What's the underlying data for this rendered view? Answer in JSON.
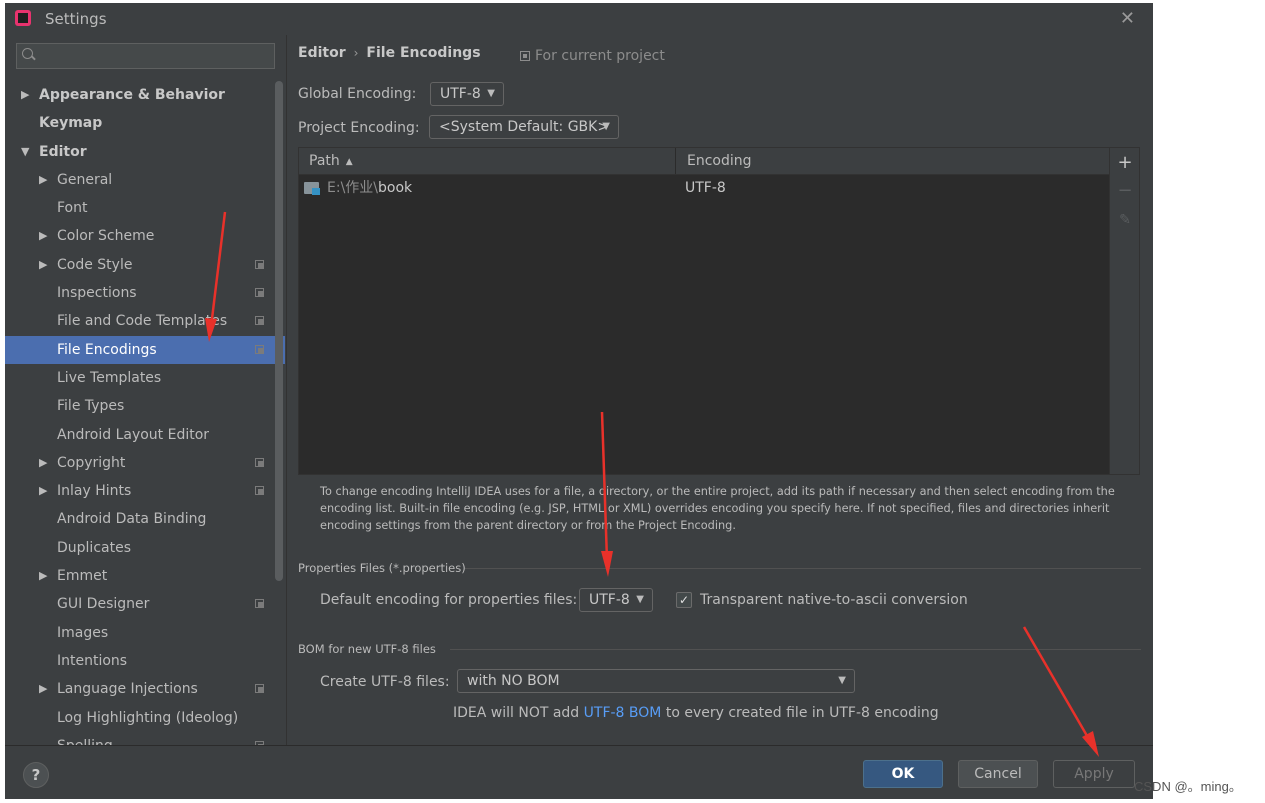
{
  "window": {
    "title": "Settings"
  },
  "sidebar": {
    "search_placeholder": "",
    "items": [
      {
        "label": "Appearance & Behavior",
        "level": 0,
        "arrow": "▶",
        "bold": true
      },
      {
        "label": "Keymap",
        "level": 0,
        "arrow": "",
        "bold": true
      },
      {
        "label": "Editor",
        "level": 0,
        "arrow": "▼",
        "bold": true
      },
      {
        "label": "General",
        "level": 1,
        "arrow": "▶"
      },
      {
        "label": "Font",
        "level": 1,
        "arrow": ""
      },
      {
        "label": "Color Scheme",
        "level": 1,
        "arrow": "▶"
      },
      {
        "label": "Code Style",
        "level": 1,
        "arrow": "▶",
        "project": true
      },
      {
        "label": "Inspections",
        "level": 1,
        "arrow": "",
        "project": true
      },
      {
        "label": "File and Code Templates",
        "level": 1,
        "arrow": "",
        "project": true
      },
      {
        "label": "File Encodings",
        "level": 1,
        "arrow": "",
        "project": true,
        "selected": true
      },
      {
        "label": "Live Templates",
        "level": 1,
        "arrow": ""
      },
      {
        "label": "File Types",
        "level": 1,
        "arrow": ""
      },
      {
        "label": "Android Layout Editor",
        "level": 1,
        "arrow": ""
      },
      {
        "label": "Copyright",
        "level": 1,
        "arrow": "▶",
        "project": true
      },
      {
        "label": "Inlay Hints",
        "level": 1,
        "arrow": "▶",
        "project": true
      },
      {
        "label": "Android Data Binding",
        "level": 1,
        "arrow": ""
      },
      {
        "label": "Duplicates",
        "level": 1,
        "arrow": ""
      },
      {
        "label": "Emmet",
        "level": 1,
        "arrow": "▶"
      },
      {
        "label": "GUI Designer",
        "level": 1,
        "arrow": "",
        "project": true
      },
      {
        "label": "Images",
        "level": 1,
        "arrow": ""
      },
      {
        "label": "Intentions",
        "level": 1,
        "arrow": ""
      },
      {
        "label": "Language Injections",
        "level": 1,
        "arrow": "▶",
        "project": true
      },
      {
        "label": "Log Highlighting (Ideolog)",
        "level": 1,
        "arrow": ""
      },
      {
        "label": "Spelling",
        "level": 1,
        "arrow": "",
        "project": true
      }
    ]
  },
  "content": {
    "breadcrumb_root": "Editor",
    "breadcrumb_sep": "›",
    "breadcrumb_current": "File Encodings",
    "for_current_project": "For current project",
    "global_encoding_label": "Global Encoding:",
    "global_encoding_value": "UTF-8",
    "project_encoding_label": "Project Encoding:",
    "project_encoding_value": "<System Default: GBK>",
    "table": {
      "col_path": "Path",
      "col_encoding": "Encoding",
      "rows": [
        {
          "path_prefix": "E:\\作业\\",
          "path_name": "book",
          "encoding": "UTF-8"
        }
      ],
      "add_label": "+",
      "remove_label": "−",
      "edit_label": "✎"
    },
    "hint": "To change encoding IntelliJ IDEA uses for a file, a directory, or the entire project, add its path if necessary and then select encoding from the encoding list. Built-in file encoding (e.g. JSP, HTML or XML) overrides encoding you specify here. If not specified, files and directories inherit encoding settings from the parent directory or from the Project Encoding.",
    "properties_section": "Properties Files (*.properties)",
    "default_props_label": "Default encoding for properties files:",
    "default_props_value": "UTF-8",
    "native_to_ascii_label": "Transparent native-to-ascii conversion",
    "native_to_ascii_checked": true,
    "bom_section": "BOM for new UTF-8 files",
    "create_utf8_label": "Create UTF-8 files:",
    "create_utf8_value": "with NO BOM",
    "bom_note_before": "IDEA will NOT add ",
    "bom_note_link": "UTF-8 BOM",
    "bom_note_after": " to every created file in UTF-8 encoding"
  },
  "footer": {
    "help_label": "?",
    "ok_label": "OK",
    "cancel_label": "Cancel",
    "apply_label": "Apply"
  },
  "watermark": "CSDN @。ming。",
  "colors": {
    "background": "#3c3f41",
    "selection": "#4b6eaf",
    "ok_button": "#365880",
    "link": "#589df6",
    "annotation_arrow": "#e8312a"
  },
  "icons": [
    "search-icon",
    "close-icon",
    "chevron-right-icon",
    "chevron-down-icon",
    "project-scope-icon",
    "folder-icon",
    "sort-ascending-icon",
    "dropdown-arrow-icon",
    "add-icon",
    "remove-icon",
    "edit-icon",
    "check-icon",
    "help-icon"
  ]
}
